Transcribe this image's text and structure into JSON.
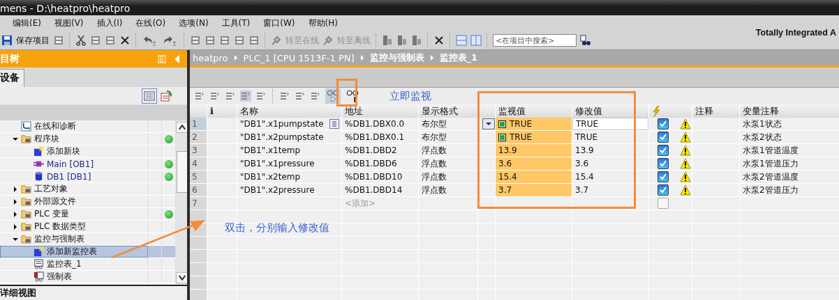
{
  "window": {
    "title": "mens - D:\\heatpro\\heatpro"
  },
  "menu": [
    "编辑(E)",
    "视图(V)",
    "插入(I)",
    "在线(O)",
    "选项(N)",
    "工具(T)",
    "窗口(W)",
    "帮助(H)"
  ],
  "toolbar": {
    "save_label": "保存项目",
    "go_online_label": "转至在线",
    "go_offline_label": "转至离线",
    "search": {
      "placeholder": "<在项目中搜索>"
    }
  },
  "brand": "Totally Integrated A",
  "project_tree": {
    "title": "目树",
    "tabs": [
      {
        "label": "设备",
        "selected": true
      }
    ],
    "footer": "详细视图",
    "items": [
      {
        "label": "在线和诊断",
        "kind": "diagnostics",
        "online": false,
        "selected": false
      },
      {
        "label": "程序块",
        "kind": "folder",
        "expanded": true,
        "online": true,
        "selected": false,
        "children": [
          {
            "label": "添加新块",
            "kind": "add",
            "online": false,
            "selected": false
          },
          {
            "label": "Main [OB1]",
            "kind": "ob",
            "online": true,
            "selected": false
          },
          {
            "label": "DB1 [DB1]",
            "kind": "db",
            "online": true,
            "selected": false
          }
        ]
      },
      {
        "label": "工艺对象",
        "kind": "folder",
        "expanded": false,
        "online": false,
        "selected": false
      },
      {
        "label": "外部源文件",
        "kind": "folder",
        "expanded": false,
        "online": false,
        "selected": false
      },
      {
        "label": "PLC 变量",
        "kind": "folder",
        "expanded": false,
        "online": true,
        "selected": false
      },
      {
        "label": "PLC 数据类型",
        "kind": "folder",
        "expanded": false,
        "online": false,
        "selected": false
      },
      {
        "label": "监控与强制表",
        "kind": "folder",
        "expanded": true,
        "online": false,
        "selected": false,
        "children": [
          {
            "label": "添加新监控表",
            "kind": "add",
            "online": false,
            "selected": true
          },
          {
            "label": "监控表_1",
            "kind": "table",
            "online": false,
            "selected": false
          },
          {
            "label": "强制表",
            "kind": "force",
            "online": false,
            "selected": false
          }
        ]
      }
    ]
  },
  "breadcrumb": [
    "heatpro",
    "PLC_1 [CPU 1513F-1 PN]",
    "监控与强制表",
    "监控表_1"
  ],
  "watch_table": {
    "columns": [
      "i",
      "名称",
      "地址",
      "显示格式",
      "监视值",
      "修改值",
      "注释",
      "变量注释"
    ],
    "rows": [
      {
        "index": "1",
        "kind": "bool",
        "name": "\"DB1\".x1pumpstate",
        "address": "%DB1.DBX0.0",
        "format": "布尔型",
        "monitor": "TRUE",
        "modify": "TRUE",
        "selected": true,
        "checked": true,
        "warning": true,
        "variable_comment": "水泵1状态"
      },
      {
        "index": "2",
        "kind": "bool",
        "name": "\"DB1\".x2pumpstate",
        "address": "%DB1.DBX0.1",
        "format": "布尔型",
        "monitor": "TRUE",
        "modify": "TRUE",
        "selected": false,
        "checked": true,
        "warning": true,
        "variable_comment": "水泵2状态"
      },
      {
        "index": "3",
        "kind": "float",
        "name": "\"DB1\".x1temp",
        "address": "%DB1.DBD2",
        "format": "浮点数",
        "monitor": "13.9",
        "modify": "13.9",
        "selected": false,
        "checked": true,
        "warning": true,
        "variable_comment": "水泵1管道温度"
      },
      {
        "index": "4",
        "kind": "float",
        "name": "\"DB1\".x1pressure",
        "address": "%DB1.DBD6",
        "format": "浮点数",
        "monitor": "3.6",
        "modify": "3.6",
        "selected": false,
        "checked": true,
        "warning": true,
        "variable_comment": "水泵1管道压力"
      },
      {
        "index": "5",
        "kind": "float",
        "name": "\"DB1\".x2temp",
        "address": "%DB1.DBD10",
        "format": "浮点数",
        "monitor": "15.4",
        "modify": "15.4",
        "selected": false,
        "checked": true,
        "warning": true,
        "variable_comment": "水泵2管道温度"
      },
      {
        "index": "6",
        "kind": "float",
        "name": "\"DB1\".x2pressure",
        "address": "%DB1.DBD14",
        "format": "浮点数",
        "monitor": "3.7",
        "modify": "3.7",
        "selected": false,
        "checked": true,
        "warning": true,
        "variable_comment": "水泵2管道压力"
      },
      {
        "index": "7",
        "kind": "new",
        "address_placeholder": "<添加>",
        "selected": false,
        "checked": false,
        "warning": false
      }
    ]
  },
  "annotations": [
    {
      "text": "立即监视"
    },
    {
      "text": "双击，分别输入修改值"
    }
  ]
}
